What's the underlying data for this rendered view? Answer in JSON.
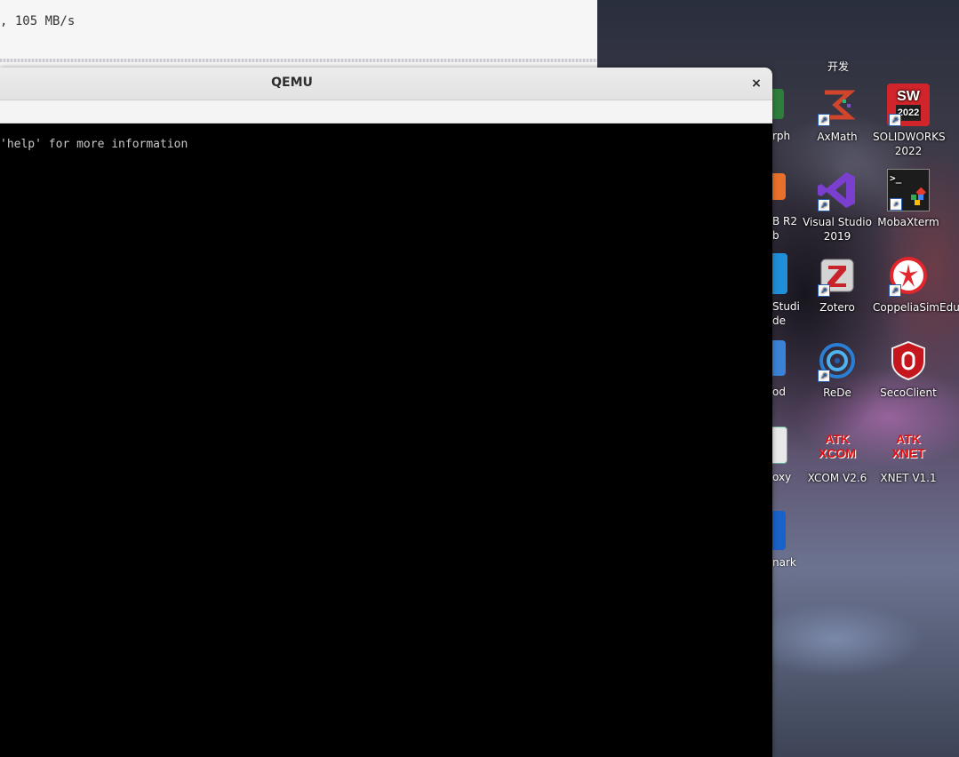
{
  "background_terminal": {
    "text": ", 105 MB/s"
  },
  "qemu_window": {
    "title": "QEMU",
    "close_glyph": "×",
    "console_line": "'help' for more information"
  },
  "desktop": {
    "top_label": "开发",
    "partial_labels": [
      "rph",
      "B R2",
      "b",
      "Studi",
      "de",
      "od",
      "oxy",
      "nark"
    ],
    "icons": [
      {
        "label": "AxMath",
        "icon": "axmath-icon"
      },
      {
        "label": "SOLIDWORKS 2022",
        "icon": "solidworks-icon",
        "badge": "2022"
      },
      {
        "label": "Visual Studio 2019",
        "icon": "visual-studio-icon"
      },
      {
        "label": "MobaXterm",
        "icon": "mobaxterm-icon"
      },
      {
        "label": "Zotero",
        "icon": "zotero-icon"
      },
      {
        "label": "CoppeliaSimEdu",
        "icon": "coppeliasim-icon"
      },
      {
        "label": "ReDe",
        "icon": "rede-icon"
      },
      {
        "label": "SecoClient",
        "icon": "secoclient-icon"
      },
      {
        "label": "XCOM V2.6",
        "icon": "xcom-icon",
        "glyph_text": "ATK XCOM"
      },
      {
        "label": "XNET V1.1",
        "icon": "xnet-icon",
        "glyph_text": "ATK XNET"
      }
    ],
    "colors": {
      "atk_red": "#e01010",
      "vs_purple": "#7b3fd0",
      "sw_red": "#d2252b"
    }
  }
}
